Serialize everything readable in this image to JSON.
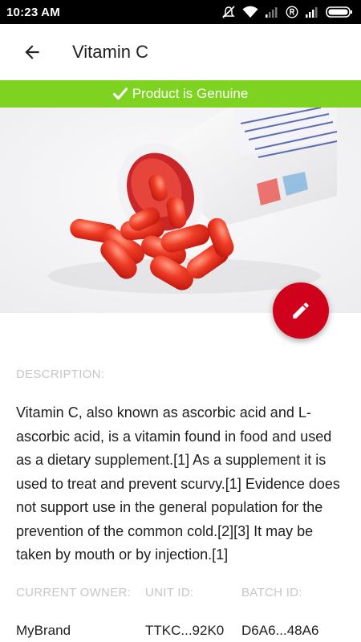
{
  "status_bar": {
    "time": "10:23 AM",
    "icons": [
      "mute-icon",
      "wifi-icon",
      "signal-icon",
      "registered-icon",
      "signal-icon",
      "battery-icon"
    ]
  },
  "app_bar": {
    "back_icon": "arrow-left-icon",
    "title": "Vitamin C"
  },
  "verification": {
    "icon": "checkmark-icon",
    "text": "Product is Genuine",
    "color": "#7ed321"
  },
  "fab": {
    "icon": "pencil-icon",
    "color": "#d0021b"
  },
  "description": {
    "label": "DESCRIPTION:",
    "text": "Vitamin C, also known as ascorbic acid and L-ascorbic acid, is a vitamin found in food and used as a dietary supplement.[1] As a supplement it is used to treat and prevent scurvy.[1] Evidence does not support use in the general population for the prevention of the common cold.[2][3] It may be taken by mouth or by injection.[1]"
  },
  "details": {
    "owner_label": "CURRENT OWNER:",
    "owner_value": "MyBrand",
    "unit_label": "UNIT ID:",
    "unit_value": "TTKC...92K0",
    "batch_label": "BATCH ID:",
    "batch_value": "D6A6...48A6"
  }
}
